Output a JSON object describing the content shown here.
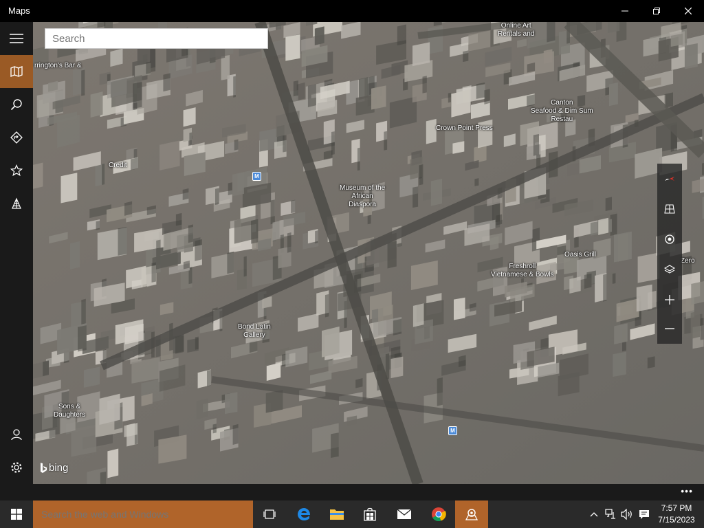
{
  "window": {
    "title": "Maps"
  },
  "search": {
    "placeholder": "Search"
  },
  "rail": {
    "items": [
      {
        "name": "menu-icon"
      },
      {
        "name": "map-icon",
        "active": true
      },
      {
        "name": "search-icon"
      },
      {
        "name": "directions-icon"
      },
      {
        "name": "favorites-icon"
      },
      {
        "name": "3d-cities-icon"
      },
      {
        "name": "account-icon"
      },
      {
        "name": "settings-icon"
      }
    ]
  },
  "map": {
    "pois": [
      {
        "label": "rrington's Bar &"
      },
      {
        "label": "Credit"
      },
      {
        "label": "Museum of the\nAfrican\nDiaspora"
      },
      {
        "label": "Crown Point Press"
      },
      {
        "label": "Canton\nSeafood & Dim Sum\nRestau"
      },
      {
        "label": "Online Art\nRentals and"
      },
      {
        "label": "Freshroll\nVietnamese & Bowls"
      },
      {
        "label": "Oasis Grill"
      },
      {
        "label": "Zero"
      },
      {
        "label": "Bond Latin\nGallery"
      },
      {
        "label": "Sons &\nDaughters"
      }
    ],
    "metro_label": "M",
    "attribution": "bing"
  },
  "controls": {
    "items": [
      "compass-icon",
      "tilt-icon",
      "locate-icon",
      "layers-icon",
      "zoom-in-icon",
      "zoom-out-icon"
    ]
  },
  "bottom": {
    "more": "•••"
  },
  "taskbar": {
    "search_placeholder": "Search the web and Windows",
    "time": "7:57 PM",
    "date": "7/15/2023"
  },
  "colors": {
    "accent": "#b0642a",
    "rail_active": "#9a5a25",
    "metro": "#4a8ad8"
  }
}
